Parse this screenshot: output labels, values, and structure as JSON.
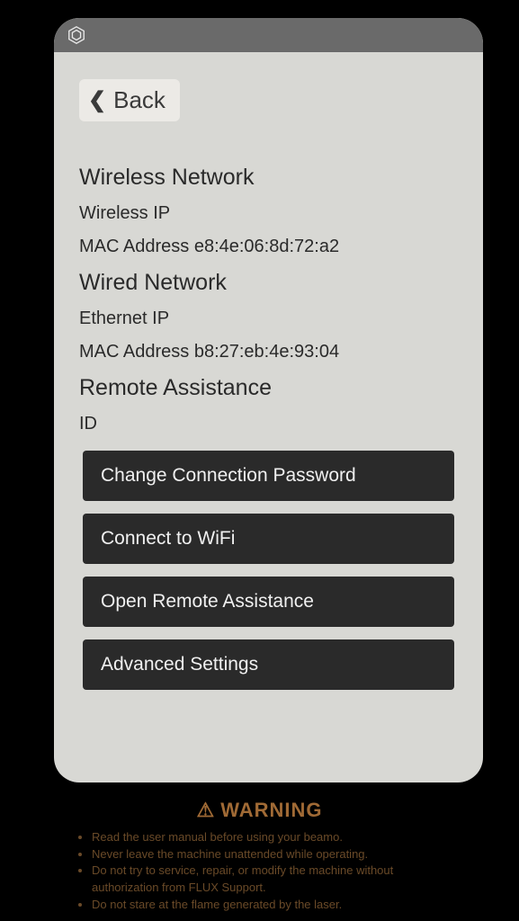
{
  "header": {
    "back_label": "Back"
  },
  "wireless": {
    "title": "Wireless Network",
    "ip_label": "Wireless IP",
    "mac_label": "MAC Address",
    "mac_value": "e8:4e:06:8d:72:a2"
  },
  "wired": {
    "title": "Wired Network",
    "ip_label": "Ethernet IP",
    "mac_label": "MAC Address",
    "mac_value": "b8:27:eb:4e:93:04"
  },
  "remote": {
    "title": "Remote Assistance",
    "id_label": "ID"
  },
  "actions": {
    "change_password": "Change Connection Password",
    "connect_wifi": "Connect to WiFi",
    "open_remote": "Open Remote Assistance",
    "advanced": "Advanced Settings"
  },
  "warning": {
    "title": "WARNING",
    "items": [
      "Read the user manual before using your beamo.",
      "Never leave the machine unattended while operating.",
      "Do not try to service, repair, or modify the machine without authorization from FLUX Support.",
      "Do not stare at the flame generated by the laser."
    ]
  }
}
